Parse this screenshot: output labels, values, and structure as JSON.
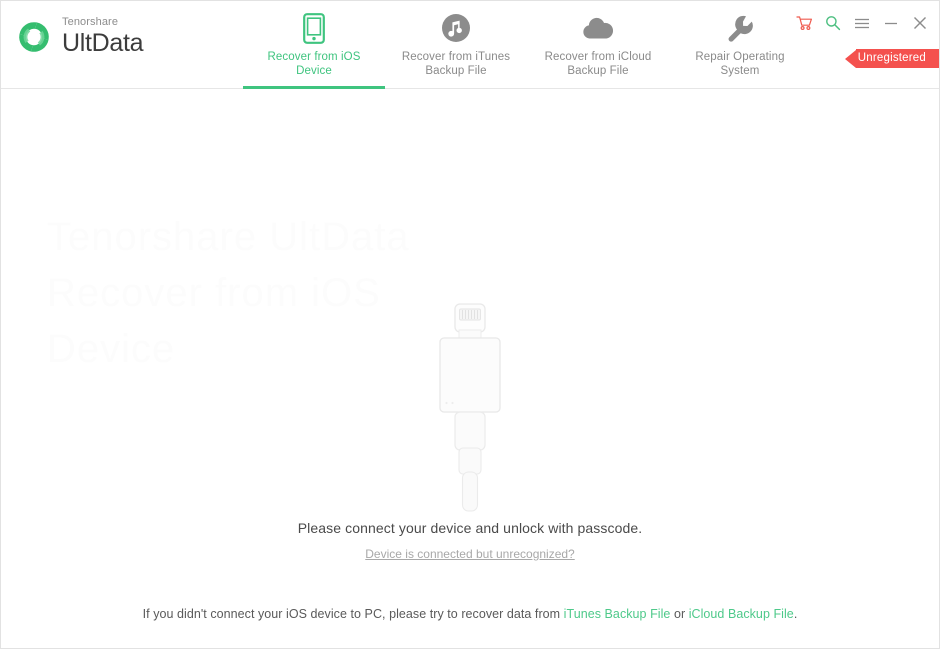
{
  "app": {
    "brand_sub": "Tenorshare",
    "brand_name": "UltData",
    "logo_icon": "ultdata-ring-logo",
    "accent_green": "#3fc47f",
    "link_green": "#4ec98a",
    "ribbon_red": "#f4514e",
    "watermark_text": "Tenorshare UltData\nRecover from iOS Device"
  },
  "tabs": [
    {
      "label": "Recover from iOS\nDevice",
      "icon": "phone-icon",
      "active": true
    },
    {
      "label": "Recover from iTunes\nBackup File",
      "icon": "itunes-music-note-icon",
      "active": false
    },
    {
      "label": "Recover from iCloud\nBackup File",
      "icon": "cloud-icon",
      "active": false
    },
    {
      "label": "Repair Operating\nSystem",
      "icon": "wrench-icon",
      "active": false
    }
  ],
  "window_controls": [
    {
      "name": "cart-icon",
      "label": "Buy"
    },
    {
      "name": "search-icon",
      "label": "Search"
    },
    {
      "name": "menu-icon",
      "label": "Menu"
    },
    {
      "name": "minimize-icon",
      "label": "Minimize"
    },
    {
      "name": "close-icon",
      "label": "Close"
    }
  ],
  "ribbon": {
    "label": "Unregistered"
  },
  "main": {
    "illustration": "lightning-connector-cable",
    "prompt": "Please connect your device and unlock with passcode.",
    "prompt_link": "Device is connected but unrecognized?"
  },
  "footer": {
    "text_before": "If you didn't connect your iOS device to PC, please try to recover data from ",
    "link_itunes": "iTunes Backup File",
    "text_middle": " or ",
    "link_icloud": "iCloud Backup File",
    "text_after": "."
  }
}
